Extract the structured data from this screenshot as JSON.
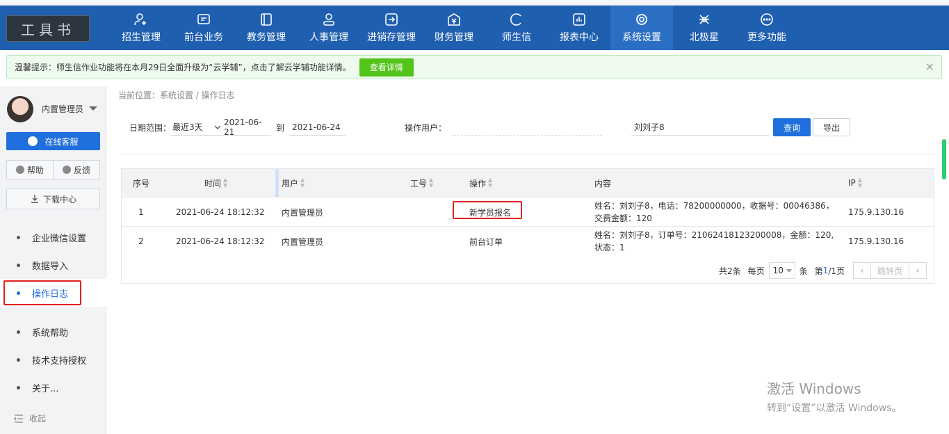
{
  "header": {
    "logo_text": "工具书",
    "nav": [
      {
        "label": "招生管理",
        "icon": "person-add-icon"
      },
      {
        "label": "前台业务",
        "icon": "screen-icon"
      },
      {
        "label": "教务管理",
        "icon": "book-icon"
      },
      {
        "label": "人事管理",
        "icon": "person-icon"
      },
      {
        "label": "进销存管理",
        "icon": "inventory-icon"
      },
      {
        "label": "财务管理",
        "icon": "money-icon"
      },
      {
        "label": "师生信",
        "icon": "chat-icon"
      },
      {
        "label": "报表中心",
        "icon": "report-icon"
      },
      {
        "label": "系统设置",
        "icon": "settings-icon"
      },
      {
        "label": "北极星",
        "icon": "star-icon"
      },
      {
        "label": "更多功能",
        "icon": "more-icon"
      }
    ],
    "active_index": 8
  },
  "notice": {
    "text": "温馨提示：师生信作业功能将在本月29日全面升级为“云学辅”，点击了解云学辅功能详情。",
    "button": "查看详情",
    "close": "×"
  },
  "sidebar": {
    "user_name": "内置管理员",
    "service_button": "在线客服",
    "help": "帮助",
    "feedback": "反馈",
    "download": "下载中心",
    "menu": [
      {
        "label": "企业微信设置"
      },
      {
        "label": "数据导入"
      },
      {
        "label": "操作日志"
      },
      {
        "label": "系统帮助"
      },
      {
        "label": "技术支持授权"
      },
      {
        "label": "关于..."
      }
    ],
    "active_menu_index": 2,
    "collapse": "收起"
  },
  "breadcrumb": "当前位置：系统设置 / 操作日志",
  "filters": {
    "date_label": "日期范围：",
    "date_preset": "最近3天",
    "date_from": "2021-06-21",
    "date_to_sep": "到",
    "date_to": "2021-06-24",
    "user_label": "操作用户：",
    "user_value": "",
    "search_value": "刘刘子8",
    "query_button": "查询",
    "export_button": "导出"
  },
  "table": {
    "columns": [
      "序号",
      "时间",
      "用户",
      "工号",
      "操作",
      "内容",
      "IP"
    ],
    "rows": [
      {
        "index": "1",
        "time": "2021-06-24 18:12:32",
        "user": "内置管理员",
        "staff_no": "",
        "operation": "新学员报名",
        "content": "姓名：刘刘子8，电话：78200000000，收据号：00046386，交费金额：120",
        "ip": "175.9.130.16"
      },
      {
        "index": "2",
        "time": "2021-06-24 18:12:32",
        "user": "内置管理员",
        "staff_no": "",
        "operation": "前台订单",
        "content": "姓名：刘刘子8，订单号：21062418123200008，金额：120,状态：1",
        "ip": "175.9.130.16"
      }
    ]
  },
  "pager": {
    "total": "共2条",
    "per_page_label": "每页",
    "per_page": "10",
    "unit": "条",
    "page_prefix": "第",
    "current_page": "1",
    "page_suffix": "/1页",
    "jump": "跳转页",
    "prev": "‹",
    "next": "›"
  },
  "watermark": {
    "line1": "激活 Windows",
    "line2": "转到“设置”以激活 Windows。"
  }
}
